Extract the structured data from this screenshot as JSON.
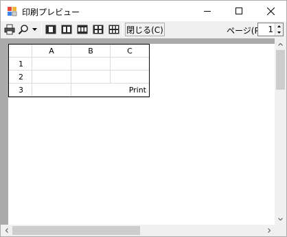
{
  "window": {
    "title": "印刷プレビュー"
  },
  "toolbar": {
    "close_label": "閉じる(C)",
    "page_label": "ページ(P)",
    "page_value": "1"
  },
  "sheet": {
    "columns": [
      "A",
      "B",
      "C"
    ],
    "rows": [
      {
        "header": "1",
        "cells": [
          "",
          "",
          ""
        ]
      },
      {
        "header": "2",
        "cells": [
          "",
          "",
          ""
        ]
      },
      {
        "header": "3",
        "cells": [
          "",
          "",
          "Print"
        ]
      }
    ]
  },
  "colors": {
    "preview_background": "#ababab",
    "window_background": "#f0f0f0"
  },
  "icons": [
    "app-icon",
    "printer-icon",
    "zoom-icon",
    "dropdown-arrow-icon",
    "one-page-icon",
    "two-pages-icon",
    "three-pages-icon",
    "four-pages-icon",
    "six-pages-icon",
    "minimize-icon",
    "maximize-icon",
    "close-icon"
  ]
}
